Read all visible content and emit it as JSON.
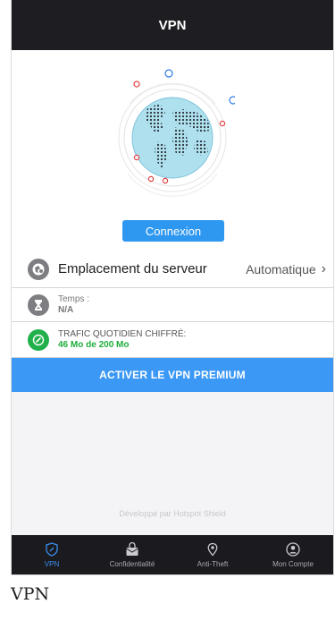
{
  "header": {
    "title": "VPN"
  },
  "hero": {
    "connect_label": "Connexion"
  },
  "server": {
    "label": "Emplacement du serveur",
    "value": "Automatique",
    "chevron": "›"
  },
  "time": {
    "label": "Temps :",
    "value": "N/A"
  },
  "traffic": {
    "label": "TRAFIC QUOTIDIEN CHIFFRÉ:",
    "value": "46 Mo de 200 Mo"
  },
  "premium": {
    "label": "ACTIVER LE VPN PREMIUM"
  },
  "footer": {
    "note": "Développé par Hotspot Shield"
  },
  "tabs": [
    {
      "label": "VPN",
      "icon": "shield-icon",
      "active": true
    },
    {
      "label": "Confidentialité",
      "icon": "privacy-icon",
      "active": false
    },
    {
      "label": "Anti-Theft",
      "icon": "location-pin-icon",
      "active": false
    },
    {
      "label": "Mon Compte",
      "icon": "account-icon",
      "active": false
    }
  ],
  "caption": "VPN",
  "colors": {
    "accent": "#3b98f5",
    "topbar": "#1e1e22",
    "traffic_green": "#1eae3a",
    "tab_active": "#3b8ef0"
  }
}
